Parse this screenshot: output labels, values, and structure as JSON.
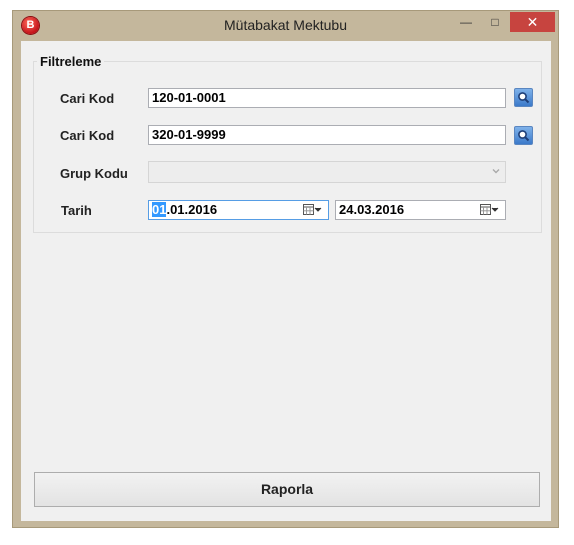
{
  "window": {
    "title": "Mütabakat Mektubu",
    "icon_letter": "B",
    "minimize_glyph": "—",
    "maximize_glyph": "□",
    "close_glyph": "✕"
  },
  "filter": {
    "legend": "Filtreleme",
    "cari_kod_1": {
      "label": "Cari Kod",
      "value": "120-01-0001"
    },
    "cari_kod_2": {
      "label": "Cari Kod",
      "value": "320-01-9999"
    },
    "grup_kodu": {
      "label": "Grup Kodu",
      "value": ""
    },
    "tarih": {
      "label": "Tarih",
      "start_selected": "01",
      "start_rest": ".01.2016",
      "end": "24.03.2016"
    }
  },
  "actions": {
    "report_label": "Raporla"
  },
  "colors": {
    "close_button": "#c7443f",
    "selection": "#3399ff",
    "search_button": "#3b79c9"
  },
  "icons": [
    "search-icon",
    "calendar-icon",
    "chevron-down-icon"
  ]
}
